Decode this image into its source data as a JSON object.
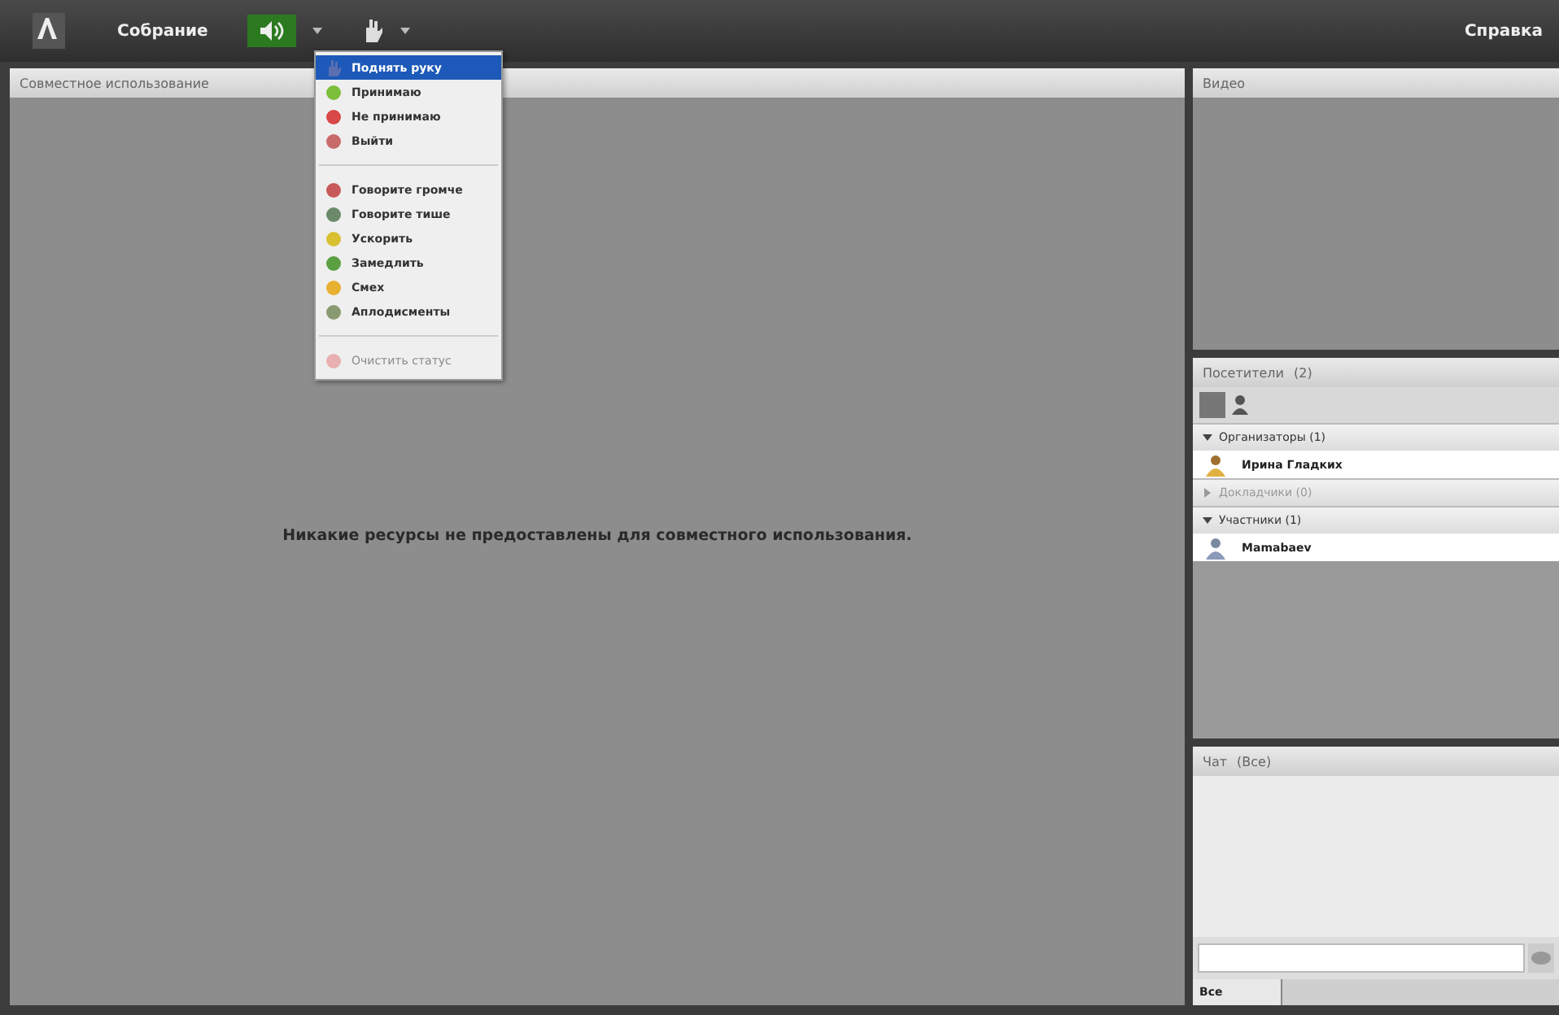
{
  "top_bar": {
    "menu": "Собрание",
    "speaker": {
      "on": true
    },
    "help": "Справка"
  },
  "status_menu": {
    "items": [
      {
        "kind": "item",
        "label": "Поднять руку",
        "selected": true
      },
      {
        "kind": "item",
        "label": "Принимаю",
        "selected": false
      },
      {
        "kind": "item",
        "label": "Не принимаю",
        "selected": false
      },
      {
        "kind": "item",
        "label": "Выйти",
        "selected": false
      },
      {
        "kind": "separator"
      },
      {
        "kind": "item",
        "label": "Говорите громче",
        "selected": false
      },
      {
        "kind": "item",
        "label": "Говорите тише",
        "selected": false
      },
      {
        "kind": "item",
        "label": "Ускорить",
        "selected": false
      },
      {
        "kind": "item",
        "label": "Замедлить",
        "selected": false
      },
      {
        "kind": "item",
        "label": "Смех",
        "selected": false
      },
      {
        "kind": "item",
        "label": "Аплодисменты",
        "selected": false
      },
      {
        "kind": "separator"
      },
      {
        "kind": "disabled",
        "label": "Очистить статус",
        "selected": false
      }
    ]
  },
  "share_panel": {
    "title": "Совместное использование",
    "message": "Никакие ресурсы не предоставлены для совместного использования."
  },
  "video_panel": {
    "title": "Видео"
  },
  "attendees_panel": {
    "title": "Посетители",
    "count": "(2)",
    "groups": [
      {
        "label": "Организаторы (1)",
        "expanded": true,
        "children": [
          {
            "name": "Ирина Гладких"
          }
        ]
      },
      {
        "label": "Докладчики (0)",
        "expanded": false
      },
      {
        "label": "Участники (1)",
        "expanded": true,
        "children": [
          {
            "name": "Mamabaev"
          }
        ]
      }
    ]
  },
  "chat_panel": {
    "title": "Чат",
    "scope": "(Все)",
    "tab": "Все"
  }
}
